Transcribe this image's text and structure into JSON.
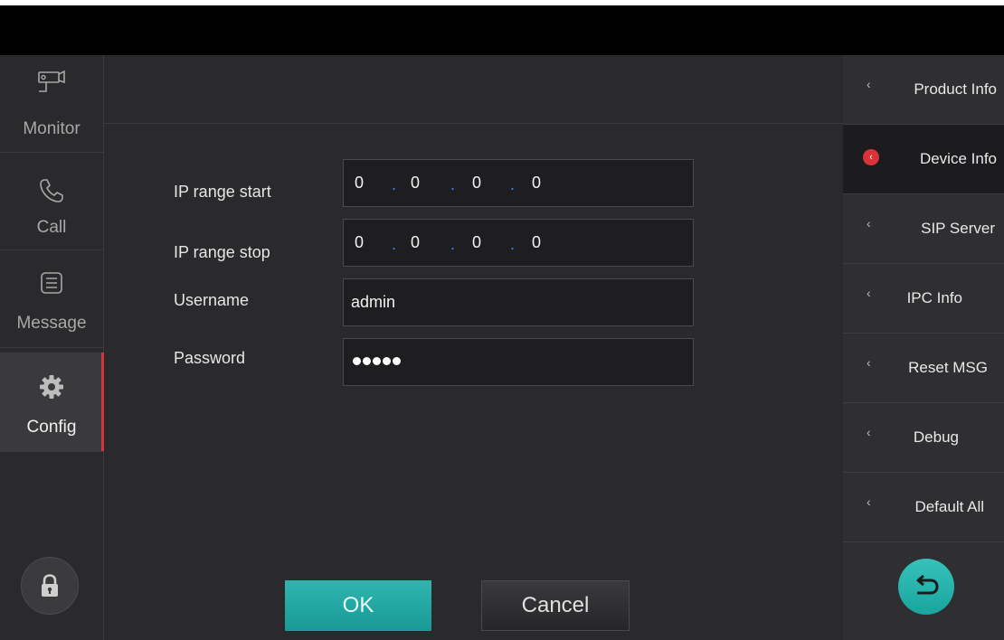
{
  "left_nav": {
    "items": [
      {
        "label": "Monitor",
        "icon": "camera-icon"
      },
      {
        "label": "Call",
        "icon": "phone-icon"
      },
      {
        "label": "Message",
        "icon": "message-icon"
      },
      {
        "label": "Config",
        "icon": "gear-icon"
      }
    ],
    "active": "Config",
    "lock_icon": "lock-icon"
  },
  "form": {
    "fields": [
      {
        "label": "IP range start",
        "type": "ip",
        "octets": [
          "0",
          "0",
          "0",
          "0"
        ]
      },
      {
        "label": "IP range stop",
        "type": "ip",
        "octets": [
          "0",
          "0",
          "0",
          "0"
        ]
      },
      {
        "label": "Username",
        "type": "text",
        "value": "admin"
      },
      {
        "label": "Password",
        "type": "password",
        "masked_length": 5
      }
    ],
    "ok_label": "OK",
    "cancel_label": "Cancel"
  },
  "right_nav": {
    "items": [
      {
        "label": "Product Info"
      },
      {
        "label": "Device Info"
      },
      {
        "label": "SIP Server"
      },
      {
        "label": "IPC Info"
      },
      {
        "label": "Reset MSG"
      },
      {
        "label": "Debug"
      },
      {
        "label": "Default All"
      }
    ],
    "active": "Device Info",
    "back_icon": "back-arrow-icon"
  },
  "colors": {
    "accent_teal": "#1fa9a3",
    "active_red": "#d8333a",
    "background": "#2a2a2c"
  }
}
